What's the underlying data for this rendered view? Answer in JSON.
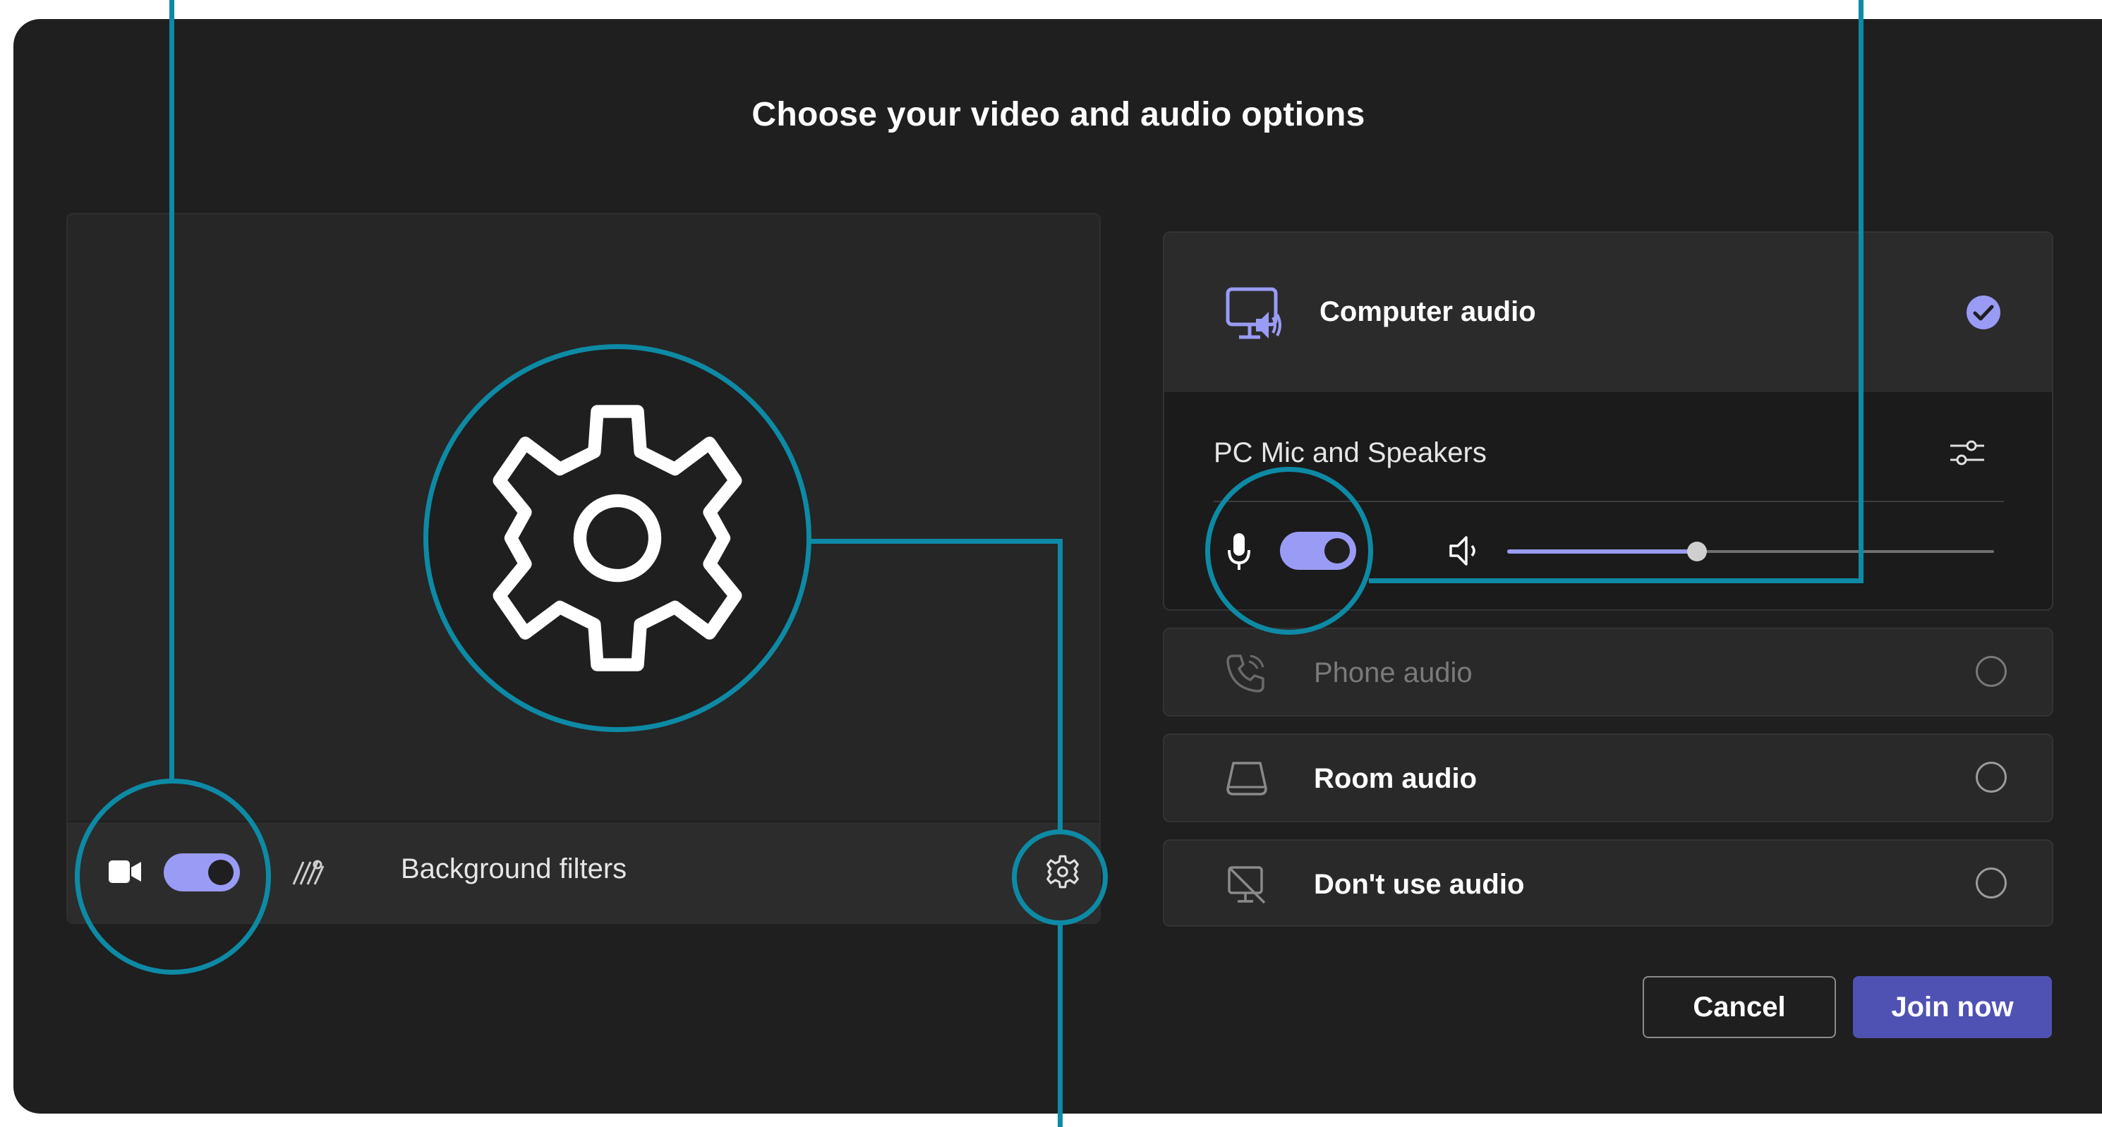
{
  "dialog": {
    "title": "Choose your video and audio options"
  },
  "video": {
    "camera_toggle_state": "on",
    "background_filters_label": "Background filters"
  },
  "audio": {
    "computer_audio": {
      "label": "Computer audio",
      "selected": true,
      "device_label": "PC Mic and Speakers",
      "mic_toggle_state": "on",
      "speaker_volume_fraction": 0.39
    },
    "options": [
      {
        "label": "Phone audio",
        "disabled": true
      },
      {
        "label": "Room audio",
        "disabled": false
      },
      {
        "label": "Don't use audio",
        "disabled": false
      }
    ]
  },
  "actions": {
    "cancel_label": "Cancel",
    "join_label": "Join now"
  },
  "colors": {
    "accent": "#9a9bf5",
    "join_button": "#4f52b2",
    "callout": "#0d8aa5",
    "dialog_background": "#1f1f1f"
  }
}
